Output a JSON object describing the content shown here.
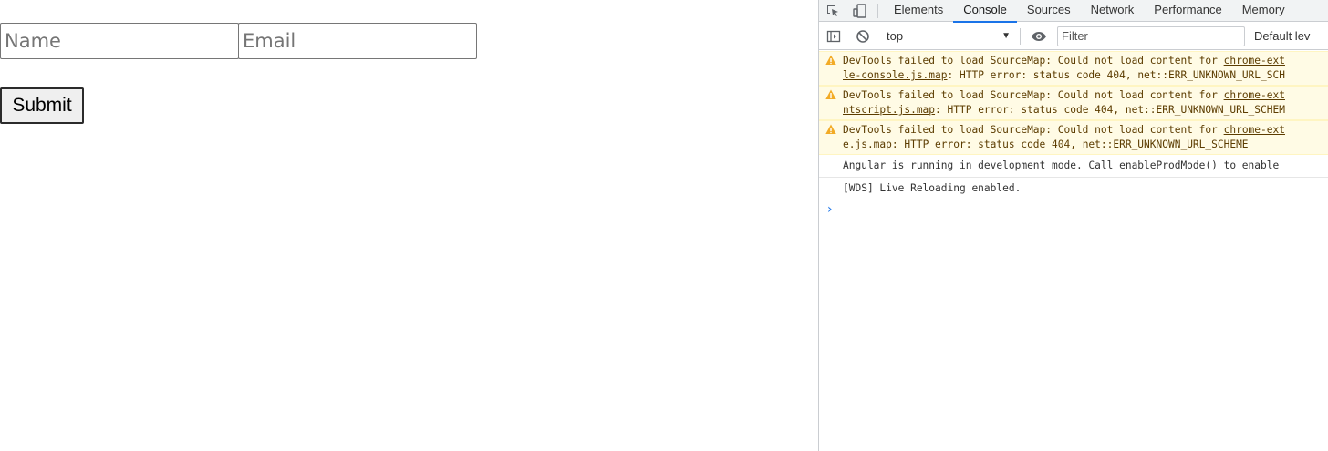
{
  "form": {
    "name_placeholder": "Name",
    "email_placeholder": "Email",
    "submit_label": "Submit"
  },
  "devtools": {
    "tabs": [
      {
        "label": "Elements"
      },
      {
        "label": "Console",
        "active": true
      },
      {
        "label": "Sources"
      },
      {
        "label": "Network"
      },
      {
        "label": "Performance"
      },
      {
        "label": "Memory"
      }
    ],
    "context": "top",
    "filter_placeholder": "Filter",
    "levels_label": "Default lev",
    "messages": [
      {
        "type": "warning",
        "text": "DevTools failed to load SourceMap: Could not load content for ",
        "link1": "chrome-ext",
        "link2": "le-console.js.map",
        "rest": ": HTTP error: status code 404, net::ERR_UNKNOWN_URL_SCH"
      },
      {
        "type": "warning",
        "text": "DevTools failed to load SourceMap: Could not load content for ",
        "link1": "chrome-ext",
        "link2": "ntscript.js.map",
        "rest": ": HTTP error: status code 404, net::ERR_UNKNOWN_URL_SCHEM"
      },
      {
        "type": "warning",
        "text": "DevTools failed to load SourceMap: Could not load content for ",
        "link1": "chrome-ext",
        "link2": "e.js.map",
        "rest": ": HTTP error: status code 404, net::ERR_UNKNOWN_URL_SCHEME"
      },
      {
        "type": "log",
        "text": "Angular is running in development mode. Call enableProdMode() to enable"
      },
      {
        "type": "log",
        "text": "[WDS] Live Reloading enabled."
      }
    ],
    "colors": {
      "accent": "#1a73e8",
      "warning_bg": "#fffbe5",
      "warning_icon": "#f2ab26"
    }
  }
}
